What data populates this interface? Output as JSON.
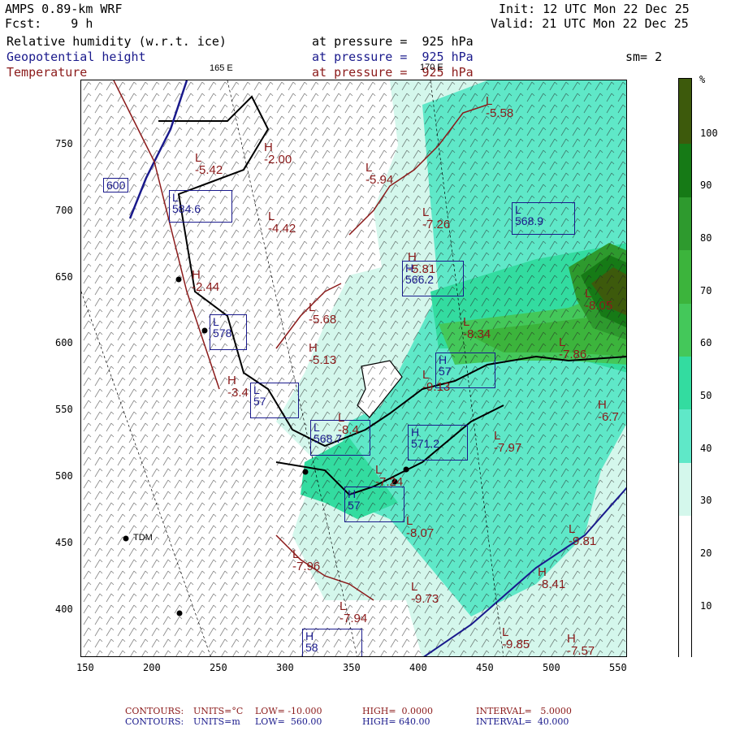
{
  "header": {
    "model": "AMPS 0.89-km WRF",
    "fcst": "Fcst:    9 h",
    "init": "Init: 12 UTC Mon 22 Dec 25",
    "valid": "Valid: 21 UTC Mon 22 Dec 25",
    "field1": "Relative humidity (w.r.t. ice)",
    "field2": "Geopotential height",
    "field3": "Temperature",
    "press1": "at pressure =  925 hPa",
    "press2": "at pressure =  925 hPa",
    "press3": "at pressure =  925 hPa",
    "smooth": "sm= 2"
  },
  "colors": {
    "rh_10": "#ffffff",
    "rh_30": "#d4f7ec",
    "rh_40": "#5fe8c8",
    "rh_50": "#33dca0",
    "rh_60": "#44c85a",
    "rh_70": "#3cb43c",
    "rh_80": "#2e9a2e",
    "rh_90": "#167a16",
    "rh_100": "#3d5a0c",
    "height_contour": "#1a1a8c",
    "temp_contour": "#8b1a1a"
  },
  "longitude_labels": [
    "165 E",
    "170 E"
  ],
  "x_axis": {
    "ticks": [
      "150",
      "200",
      "250",
      "300",
      "350",
      "400",
      "450",
      "500",
      "550"
    ]
  },
  "y_axis": {
    "ticks": [
      "750",
      "700",
      "650",
      "600",
      "550",
      "500",
      "450",
      "400"
    ]
  },
  "colorbar": {
    "unit": "%",
    "labels": [
      "100",
      "90",
      "80",
      "70",
      "60",
      "50",
      "40",
      "30",
      "20",
      "10"
    ]
  },
  "stations": [
    {
      "label": "TDM"
    }
  ],
  "height_labels": [
    {
      "marker": "L",
      "value": "600"
    },
    {
      "marker": "L",
      "value": "584.6"
    },
    {
      "marker": "L",
      "value": "568.9"
    },
    {
      "marker": "H",
      "value": "566.2"
    },
    {
      "marker": "L",
      "value": "578"
    },
    {
      "marker": "H",
      "value": "57"
    },
    {
      "marker": "L",
      "value": "57"
    },
    {
      "marker": "L",
      "value": "568.7"
    },
    {
      "marker": "H",
      "value": "571.2"
    },
    {
      "marker": "H",
      "value": "57"
    },
    {
      "marker": "H",
      "value": "58"
    }
  ],
  "temperature_labels": [
    {
      "marker": "L",
      "value": "-5.42"
    },
    {
      "marker": "H",
      "value": "-2.00"
    },
    {
      "marker": "L",
      "value": "-5.94"
    },
    {
      "marker": "L",
      "value": "-5.58"
    },
    {
      "marker": "L",
      "value": "-4.42"
    },
    {
      "marker": "L",
      "value": "-7.26"
    },
    {
      "marker": "H",
      "value": "-5.81"
    },
    {
      "marker": "H",
      "value": "-2.44"
    },
    {
      "marker": "L",
      "value": "-5.68"
    },
    {
      "marker": "L",
      "value": "-8.34"
    },
    {
      "marker": "L",
      "value": "-8.05"
    },
    {
      "marker": "L",
      "value": "-7.86"
    },
    {
      "marker": "H",
      "value": "-5.13"
    },
    {
      "marker": "L",
      "value": "-9.13"
    },
    {
      "marker": "H",
      "value": "-6.7"
    },
    {
      "marker": "H",
      "value": "-3.4"
    },
    {
      "marker": "L",
      "value": "-8.4"
    },
    {
      "marker": "L",
      "value": "-7.97"
    },
    {
      "marker": "L",
      "value": "-7.24"
    },
    {
      "marker": "L",
      "value": "-8.07"
    },
    {
      "marker": "L",
      "value": "-9.81"
    },
    {
      "marker": "L",
      "value": "-7.96"
    },
    {
      "marker": "H",
      "value": "-8.41"
    },
    {
      "marker": "L",
      "value": "-9.73"
    },
    {
      "marker": "L",
      "value": "-7.94"
    },
    {
      "marker": "L",
      "value": "-9.85"
    },
    {
      "marker": "H",
      "value": "-7.57"
    }
  ],
  "footer": {
    "temp": {
      "label": "CONTOURS:",
      "units": "UNITS=°C",
      "low": "LOW= -10.000",
      "high": "HIGH=  0.0000",
      "interval": "INTERVAL=   5.0000"
    },
    "height": {
      "label": "CONTOURS:",
      "units": "UNITS=m",
      "low": "LOW=  560.00",
      "high": "HIGH= 640.00",
      "interval": "INTERVAL=  40.000"
    }
  }
}
